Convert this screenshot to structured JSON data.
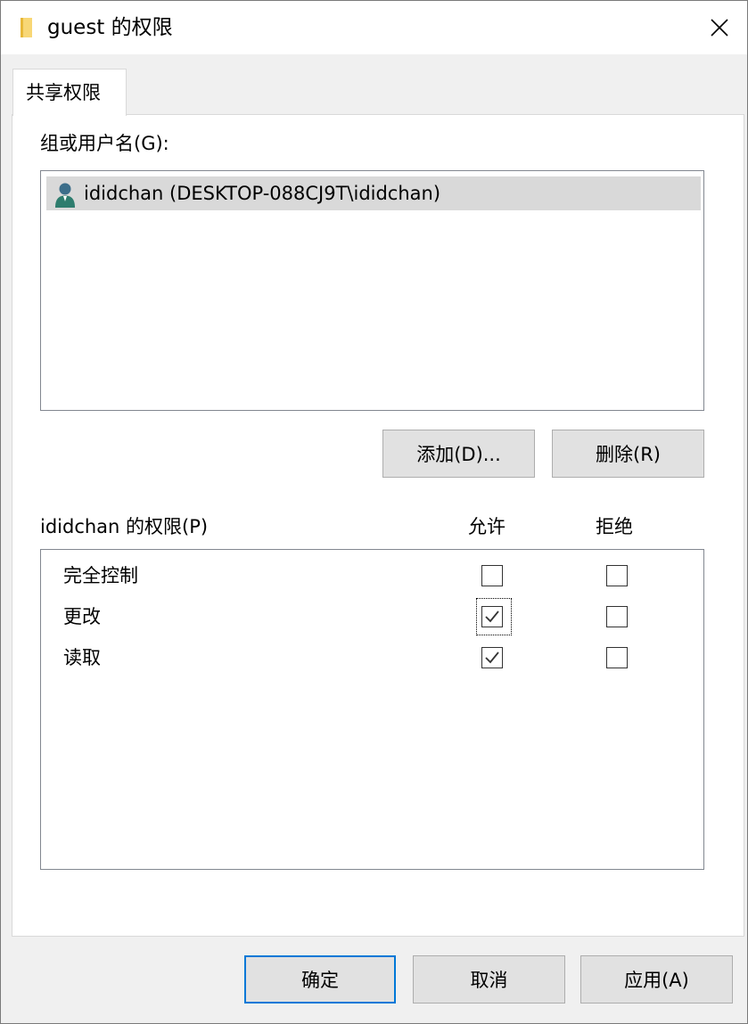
{
  "window": {
    "title": "guest 的权限"
  },
  "tabs": [
    {
      "label": "共享权限",
      "active": true
    }
  ],
  "groups": {
    "label": "组或用户名(G):",
    "items": [
      {
        "name": "ididchan (DESKTOP-088CJ9T\\ididchan)",
        "icon": "user-icon",
        "selected": true
      }
    ]
  },
  "buttons": {
    "add": "添加(D)...",
    "remove": "删除(R)"
  },
  "permissions": {
    "label": "ididchan 的权限(P)",
    "allow_header": "允许",
    "deny_header": "拒绝",
    "rows": [
      {
        "name": "完全控制",
        "allow": false,
        "deny": false
      },
      {
        "name": "更改",
        "allow": true,
        "deny": false
      },
      {
        "name": "读取",
        "allow": true,
        "deny": false
      }
    ]
  },
  "footer": {
    "ok": "确定",
    "cancel": "取消",
    "apply": "应用(A)"
  },
  "colors": {
    "focus_border": "#0078d7",
    "selection": "#d9d9d9",
    "window_bg": "#f0f0f0"
  }
}
